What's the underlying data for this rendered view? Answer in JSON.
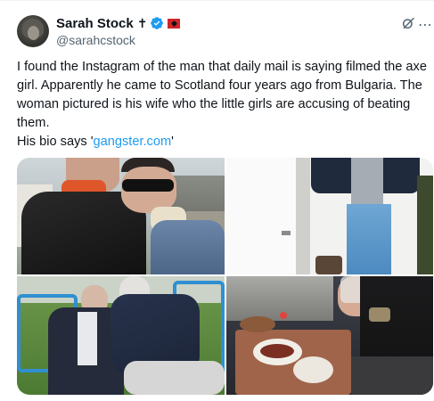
{
  "author": {
    "display_name": "Sarah Stock",
    "name_symbol": "✝",
    "handle": "@sarahcstock",
    "verified_icon": "verified-badge-icon",
    "flag_icon": "albania-flag-icon"
  },
  "header_actions": {
    "grok_icon": "grok-icon",
    "more_icon": "more-horizontal-icon",
    "more_glyph": "⋯"
  },
  "tweet": {
    "text_1": "I found the Instagram of the man that daily mail is saying filmed the axe girl. Apparently he came to Scotland four years ago from Bulgaria. The woman pictured is his wife who the little girls are accusing of beating them.",
    "bio_prefix": "His bio says '",
    "bio_link": "gangster.com",
    "bio_suffix": "'"
  },
  "media": {
    "images": [
      "photo-couple-selfie",
      "photo-jeans-mirror",
      "photo-couple-garden",
      "photo-dinner-table"
    ]
  },
  "colors": {
    "text": "#0f1419",
    "secondary": "#536471",
    "link": "#1d9bf0",
    "flag": "#d0262b"
  }
}
